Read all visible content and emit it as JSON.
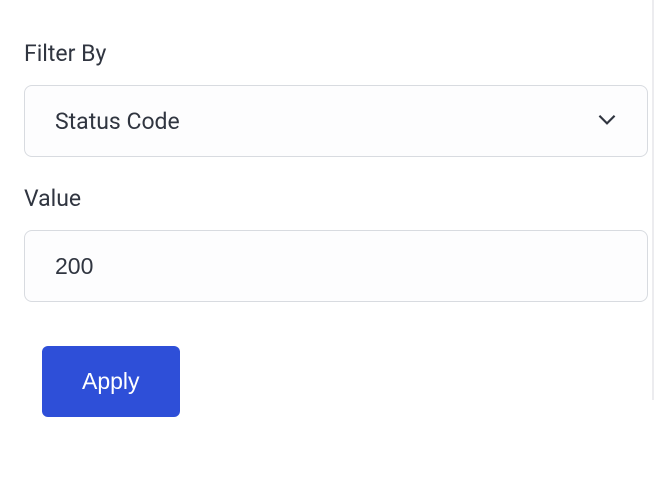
{
  "filterBy": {
    "label": "Filter By",
    "selected": "Status Code"
  },
  "value": {
    "label": "Value",
    "input": "200"
  },
  "actions": {
    "apply": "Apply"
  }
}
